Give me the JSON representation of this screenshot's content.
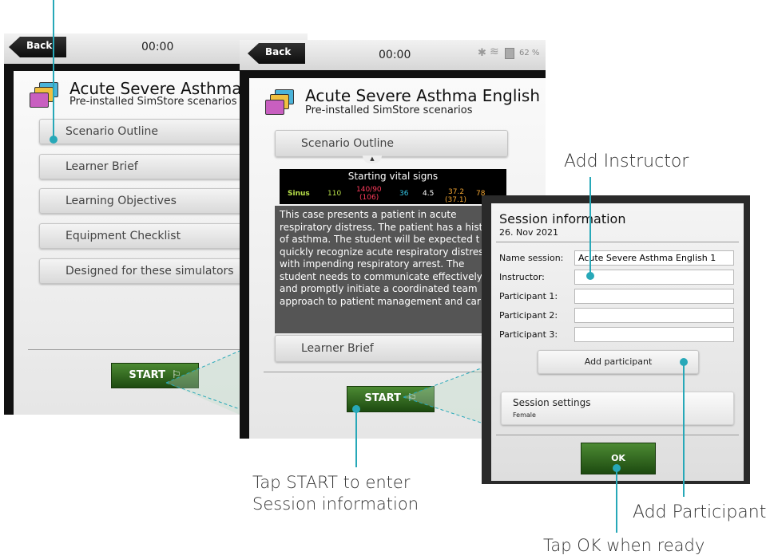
{
  "screen1": {
    "back_label": "Back",
    "timer": "00:00",
    "title": "Acute Severe Asthma Engl",
    "subtitle": "Pre-installed SimStore scenarios",
    "menu": [
      "Scenario Outline",
      "Learner Brief",
      "Learning Objectives",
      "Equipment Checklist",
      "Designed for these simulators"
    ],
    "start_label": "START"
  },
  "screen2": {
    "back_label": "Back",
    "timer": "00:00",
    "status_battery": "62 %",
    "title": "Acute Severe Asthma English",
    "subtitle": "Pre-installed SimStore scenarios",
    "scenario_outline": "Scenario Outline",
    "vitals": {
      "title": "Starting vital signs",
      "rhythm": "Sinus",
      "hr": "110",
      "bp": "140/90",
      "bp_sub": "(106)",
      "rr": "36",
      "etco2": "4.5",
      "temp": "37.2",
      "temp_sub": "(37.1)",
      "spo2": "78"
    },
    "description_lines": [
      "This case presents a patient in acute",
      "respiratory distress. The patient has a hist",
      "of asthma. The student will be expected t",
      "quickly recognize acute respiratory distres",
      "with impending respiratory arrest. The",
      "student needs to communicate effectively",
      "and promptly initiate a coordinated team",
      "approach to patient management and car"
    ],
    "learner_brief": "Learner Brief",
    "start_label": "START"
  },
  "session": {
    "title": "Session information",
    "date": "26. Nov 2021",
    "labels": {
      "name": "Name session:",
      "instructor": "Instructor:",
      "p1": "Participant 1:",
      "p2": "Participant 2:",
      "p3": "Participant 3:"
    },
    "values": {
      "name": "Acute Severe Asthma English 1",
      "instructor": "",
      "p1": "",
      "p2": "",
      "p3": ""
    },
    "add_participant_label": "Add participant",
    "settings_title": "Session settings",
    "settings_value": "Female",
    "ok_label": "OK"
  },
  "annotations": {
    "add_instructor": "Add Instructor",
    "tap_start_line1": "Tap START to enter",
    "tap_start_line2": "Session information",
    "add_participant": "Add Participant",
    "tap_ok": "Tap OK when ready"
  },
  "colors": {
    "accent_teal": "#27a8b8",
    "start_green": "#2f6b1f",
    "vital_green": "#b8e04a",
    "vital_red": "#ff3b5c",
    "vital_cyan": "#34c6e6",
    "vital_orange": "#f2a531"
  }
}
